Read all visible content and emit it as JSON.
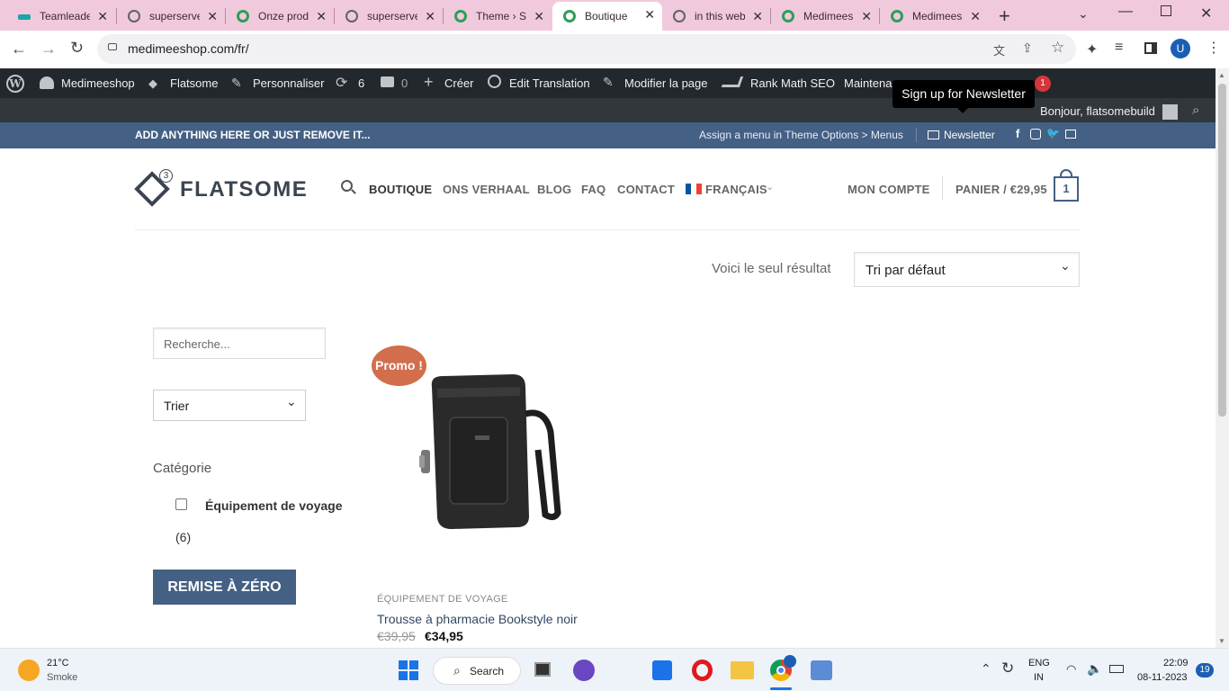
{
  "browser": {
    "tabs": [
      {
        "title": "Teamleader",
        "color": "#1aa6a6"
      },
      {
        "title": "superserver",
        "color": "#5f6368"
      },
      {
        "title": "Onze producten",
        "color": "#2e9e57"
      },
      {
        "title": "superserver",
        "color": "#5f6368"
      },
      {
        "title": "Theme › Settings",
        "color": "#2e9e57"
      },
      {
        "title": "Boutique",
        "color": "#2e9e57"
      },
      {
        "title": "in this website",
        "color": "#5f6368"
      },
      {
        "title": "Medimeeshop",
        "color": "#2e9e57"
      },
      {
        "title": "Medimeeshop",
        "color": "#2e9e57"
      }
    ],
    "new_tab": "+",
    "url": "medimeeshop.com/fr/",
    "profile_initial": "U"
  },
  "admin_bar": {
    "site_name": "Medimeeshop",
    "theme": "Flatsome",
    "customize": "Personnaliser",
    "updates_count": "6",
    "comments_count": "0",
    "create": "Créer",
    "edit_translation": "Edit Translation",
    "edit_page": "Modifier la page",
    "rank_math": "Rank Math SEO",
    "maintenance": "Maintena",
    "notification_count": "1",
    "greeting": "Bonjour, flatsomebuild",
    "tooltip": "Sign up for Newsletter"
  },
  "topbar": {
    "left_text": "ADD ANYTHING HERE OR JUST REMOVE IT...",
    "menu_text": "Assign a menu in Theme Options > Menus",
    "newsletter": "Newsletter"
  },
  "header": {
    "logo_text": "FLATSOME",
    "logo_badge": "3",
    "nav": [
      "BOUTIQUE",
      "ONS VERHAAL",
      "BLOG",
      "FAQ",
      "CONTACT"
    ],
    "language": "FRANÇAIS",
    "account": "MON COMPTE",
    "cart": "PANIER / €29,95",
    "cart_count": "1"
  },
  "shop": {
    "result_text": "Voici le seul résultat",
    "sort_selected": "Tri par défaut",
    "search_placeholder": "Recherche...",
    "filter_selected": "Trier",
    "category_heading": "Catégorie",
    "category_label": "Équipement de voyage",
    "category_count": "(6)",
    "reset_button": "REMISE À ZÉRO",
    "product": {
      "badge": "Promo !",
      "category": "ÉQUIPEMENT DE VOYAGE",
      "name": "Trousse à pharmacie Bookstyle noir",
      "old_price": "€39,95",
      "price": "€34,95"
    }
  },
  "taskbar": {
    "temperature": "21°C",
    "weather": "Smoke",
    "search": "Search",
    "lang": "ENG",
    "region": "IN",
    "time": "22:09",
    "date": "08-11-2023",
    "notifications": "19"
  },
  "colors": {
    "primary": "#446084",
    "promo": "#d26e4b",
    "tabstrip": "#f1c9dd",
    "adminbar": "#23282d"
  }
}
